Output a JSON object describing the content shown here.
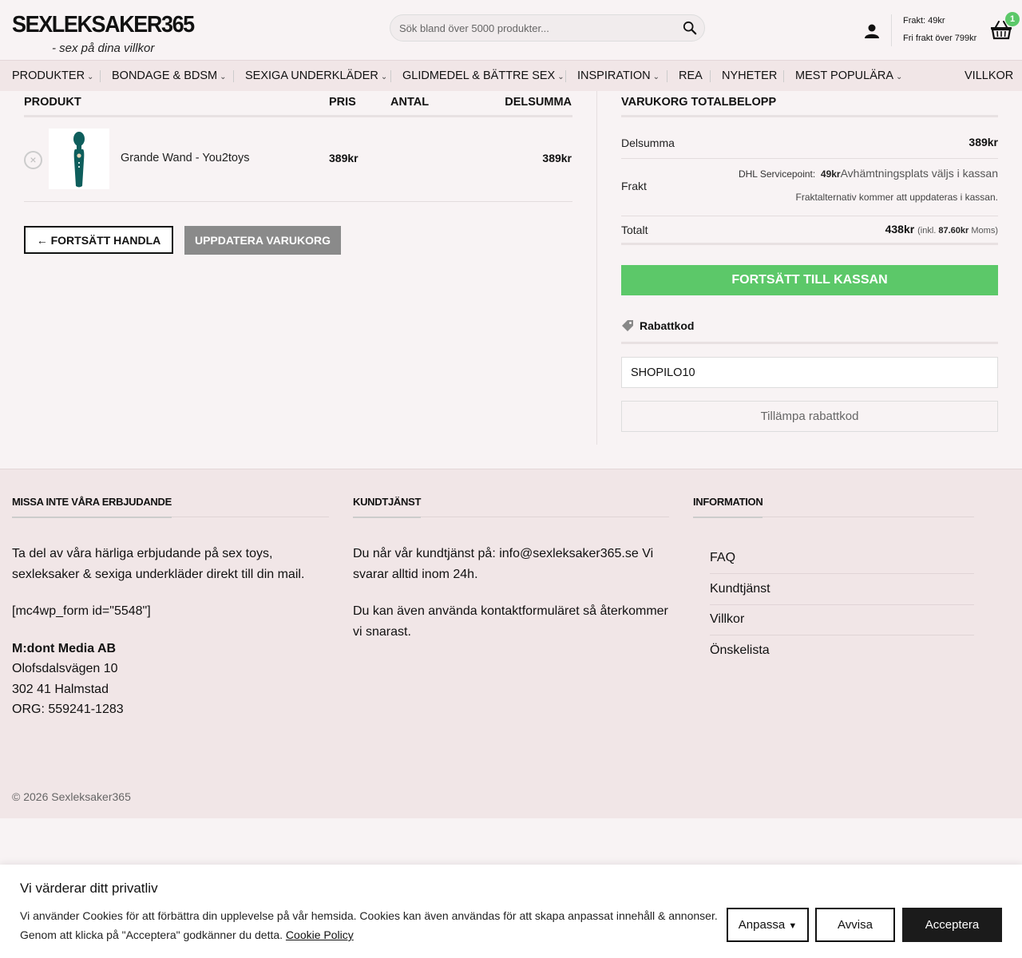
{
  "header": {
    "logo_main": "SEXLEKSAKER365",
    "logo_sub": "- sex på dina villkor",
    "search_placeholder": "Sök bland över 5000 produkter...",
    "shipping_price": "Frakt: 49kr",
    "free_shipping": "Fri frakt över 799kr",
    "cart_count": "1"
  },
  "nav": {
    "items": [
      {
        "label": "PRODUKTER"
      },
      {
        "label": "BONDAGE & BDSM"
      },
      {
        "label": "SEXIGA UNDERKLÄDER"
      },
      {
        "label": "GLIDMEDEL & BÄTTRE SEX"
      },
      {
        "label": "INSPIRATION"
      },
      {
        "label": "REA"
      },
      {
        "label": "NYHETER"
      },
      {
        "label": "MEST POPULÄRA"
      },
      {
        "label": "VILLKOR"
      }
    ]
  },
  "cart": {
    "headers": {
      "product": "PRODUKT",
      "price": "PRIS",
      "quantity": "ANTAL",
      "subtotal": "DELSUMMA"
    },
    "items": [
      {
        "name": "Grande Wand - You2toys",
        "price": "389kr",
        "subtotal": "389kr"
      }
    ],
    "continue_label": "← FORTSÄTT HANDLA",
    "update_label": "UPPDATERA VARUKORG"
  },
  "totals": {
    "title": "VARUKORG TOTALBELOPP",
    "subtotal_label": "Delsumma",
    "subtotal_value": "389kr",
    "shipping_label": "Frakt",
    "shipping_method": "DHL Servicepoint:",
    "shipping_cost": "49kr",
    "shipping_option": "Avhämtningsplats väljs i kassan",
    "shipping_note": "Fraktalternativ kommer att uppdateras i kassan.",
    "total_label": "Totalt",
    "total_value": "438kr",
    "vat_prefix": "(inkl.",
    "vat_value": "87.60kr",
    "vat_suffix": "Moms)",
    "checkout_label": "FORTSÄTT TILL KASSAN",
    "coupon_title": "Rabattkod",
    "coupon_value": "SHOPILO10",
    "apply_label": "Tillämpa rabattkod"
  },
  "footer": {
    "col1_title": "MISSA INTE VÅRA ERBJUDANDE",
    "col1_text": "Ta del av våra härliga erbjudande på sex toys, sexleksaker & sexiga underkläder direkt till din mail.",
    "col1_form": "[mc4wp_form id=\"5548\"]",
    "company": "M:dont Media AB",
    "address1": "Olofsdalsvägen 10",
    "address2": "302 41 Halmstad",
    "org": "ORG: 559241-1283",
    "col2_title": "KUNDTJÄNST",
    "col2_text1": "Du når vår kundtjänst på: info@sexleksaker365.se Vi svarar alltid inom 24h.",
    "col2_text2": "Du kan även använda kontaktformuläret så återkommer vi snarast.",
    "col3_title": "INFORMATION",
    "links": [
      {
        "label": "FAQ"
      },
      {
        "label": "Kundtjänst"
      },
      {
        "label": "Villkor"
      },
      {
        "label": "Önskelista"
      }
    ],
    "copyright": "© 2026 Sexleksaker365"
  },
  "cookie": {
    "title": "Vi värderar ditt privatliv",
    "text": "Vi använder Cookies för att förbättra din upplevelse på vår hemsida. Cookies kan även användas för att skapa anpassat innehåll & annonser. Genom att klicka på \"Acceptera\" godkänner du detta.",
    "policy_link": "Cookie Policy",
    "customize_label": "Anpassa",
    "deny_label": "Avvisa",
    "accept_label": "Acceptera"
  },
  "colors": {
    "accent_green": "#5cc869",
    "nav_bg": "#f1e6e7",
    "update_gray": "#8a8a8a",
    "wand_teal": "#0e5e5c"
  }
}
